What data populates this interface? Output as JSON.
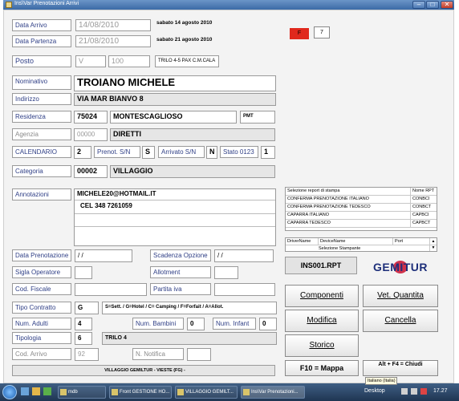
{
  "window": {
    "title": "Ins\\Var Prenotazioni Arrivi"
  },
  "colors": {
    "title_bar": "#3b6aa6",
    "label_text": "#2f3f86",
    "flag_red": "#e0281c",
    "logo_red": "#c8102e",
    "logo_blue": "#1e2f7a"
  },
  "dates": {
    "arrivo_label": "Data Arrivo",
    "arrivo_value": "14/08/2010",
    "arrivo_day": "sabato 14 agosto 2010",
    "partenza_label": "Data Partenza",
    "partenza_value": "21/08/2010",
    "partenza_day": "sabato 21 agosto 2010"
  },
  "posto": {
    "label": "Posto",
    "code": "V",
    "number": "100",
    "desc": "TRILO 4-5 PAX C.M.CALA"
  },
  "flags": {
    "red_label": "F",
    "count": "7"
  },
  "guest": {
    "nominativo_label": "Nominativo",
    "nominativo": "TROIANO MICHELE",
    "indirizzo_label": "Indirizzo",
    "indirizzo": "VIA MAR BIANVO 8",
    "residenza_label": "Residenza",
    "cap": "75024",
    "citta": "MONTESCAGLIOSO",
    "prov": "PMT",
    "agenzia_label": "Agenzia",
    "agenzia_code": "00000",
    "agenzia_name": "DIRETTI",
    "calendario_label": "CALENDARIO",
    "calendario_value": "2",
    "prenot_sn_label": "Prenot. S/N",
    "prenot_sn_value": "S",
    "arrivato_sn_label": "Arrivato S/N",
    "arrivato_sn_value": "N",
    "stato_label": "Stato 0123",
    "stato_value": "1",
    "categoria_label": "Categoria",
    "categoria_code": "00002",
    "categoria_name": "VILLAGGIO"
  },
  "annotazioni": {
    "label": "Annotazioni",
    "line1": "MICHELE20@HOTMAIL.IT",
    "line2": "CEL 348 7261059"
  },
  "reports": {
    "header_name": "Selezione report di stampa",
    "header_code": "Nome RPT",
    "rows": [
      {
        "name": "CONFERMA PRENOTAZIONE ITALIANO",
        "code": "CONBCI"
      },
      {
        "name": "CONFERMA PRENOTAZIONE TEDESCO",
        "code": "CONBCT"
      },
      {
        "name": "CAPARRA ITALIANO",
        "code": "CAPBCI"
      },
      {
        "name": "CAPARRA TEDESCO",
        "code": "CAPBCT"
      }
    ]
  },
  "drivers": {
    "col1": "DriverName",
    "col2": "DeviceName",
    "col3": "Port",
    "row1": "Selezione Stampante"
  },
  "rpt_file": "INS001.RPT",
  "logo_text": "GEMITUR",
  "lower": {
    "data_prenotazione_label": "Data Prenotazione",
    "data_prenotazione_value": "/ /",
    "scadenza_opzione_label": "Scadenza Opzione",
    "scadenza_opzione_value": "/ /",
    "sigla_label": "Sigla Operatore",
    "allotment_label": "Allotment",
    "cod_fiscale_label": "Cod. Fiscale",
    "partita_iva_label": "Partita iva",
    "tipo_contratto_label": "Tipo Contratto",
    "tipo_contratto_value": "G",
    "tipo_contratto_desc": "S=Sett. / G=Hotel / C= Camping / F=Forfait / A=Allot.",
    "num_adulti_label": "Num. Adulti",
    "num_adulti_value": "4",
    "num_bambini_label": "Num. Bambini",
    "num_bambini_value": "0",
    "num_infant_label": "Num. Infant",
    "num_infant_value": "0",
    "tipologia_label": "Tipologia",
    "tipologia_code": "6",
    "tipologia_desc": "TRILO 4",
    "cod_arrivo_label": "Cod. Arrivo",
    "cod_arrivo_value": "92",
    "n_notifica_label": "N. Notifica",
    "footer_text": "VILLAGGIO GEMILTUR - VIESTE (FG) -"
  },
  "buttons": {
    "componenti": "Componenti",
    "vet_quantita": "Vet. Quantita",
    "modifica": "Modifica",
    "cancella": "Cancella",
    "storico": "Storico",
    "mappa": "F10 = Mappa",
    "chiudi": "Alt + F4 = Chiudi"
  },
  "taskbar": {
    "tasks": [
      "mdb",
      "Front GESTIONE HO...",
      "VILLAGGIO GEMILT...",
      "Ins\\Var Prenotazioni..."
    ],
    "desktop": "Desktop",
    "language": "Italiano (Italia)",
    "time": "17.27"
  }
}
